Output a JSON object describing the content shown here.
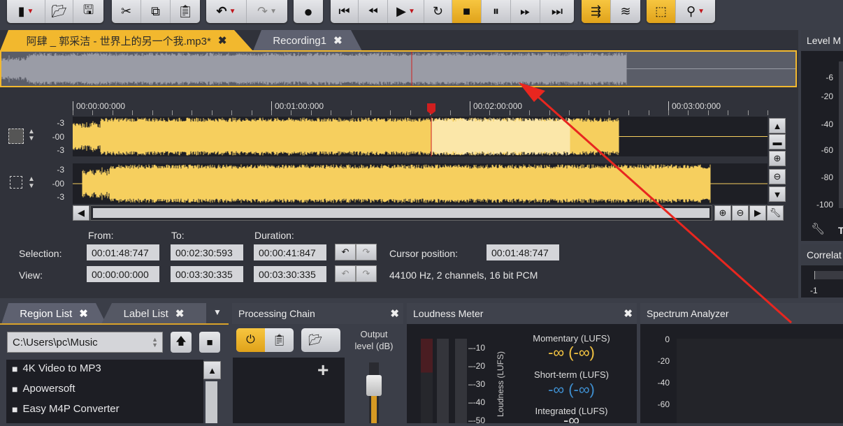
{
  "toolbar": {
    "new": "new-file-icon",
    "open": "open-folder-icon",
    "save": "save-icon",
    "cut": "cut-icon",
    "copy": "copy-icon",
    "paste": "paste-icon",
    "undo": "undo-icon",
    "redo": "redo-icon",
    "record": "record-icon",
    "go_start": "skip-start-icon",
    "rewind": "rewind-icon",
    "play": "play-icon",
    "loop": "loop-icon",
    "stop": "stop-icon",
    "pause": "pause-icon",
    "fast_forward": "fast-forward-icon",
    "go_end": "skip-end-icon",
    "accent": "#f2b82e"
  },
  "tabs": [
    {
      "label": "阿肆 _ 郭采洁 - 世界上的另一个我.mp3*",
      "active": true
    },
    {
      "label": "Recording1",
      "active": false
    }
  ],
  "close_glyph": "✖",
  "ruler": [
    "00:00:00:000",
    "00:01:00:000",
    "00:02:00:000",
    "00:03:00:000"
  ],
  "track_scale": [
    "-3",
    "-00",
    "-3"
  ],
  "selection": {
    "from_label": "From:",
    "to_label": "To:",
    "duration_label": "Duration:",
    "selection_label": "Selection:",
    "view_label": "View:",
    "sel_from": "00:01:48:747",
    "sel_to": "00:02:30:593",
    "sel_dur": "00:00:41:847",
    "view_from": "00:00:00:000",
    "view_to": "00:03:30:335",
    "view_dur": "00:03:30:335",
    "cursor_label": "Cursor position:",
    "cursor": "00:01:48:747",
    "format": "44100 Hz, 2 channels, 16 bit PCM"
  },
  "level_meter": {
    "title": "Level M",
    "ticks": [
      "-6",
      "-20",
      "-40",
      "-60",
      "-80",
      "-100"
    ],
    "t": "T"
  },
  "correlation": {
    "title": "Correlat",
    "tick": "-1"
  },
  "region_tabs": [
    {
      "label": "Region List"
    },
    {
      "label": "Label List"
    }
  ],
  "file_browser": {
    "path": "C:\\Users\\pc\\Music",
    "items": [
      "4K Video to MP3",
      "Apowersoft",
      "Easy M4P Converter"
    ]
  },
  "processing": {
    "title": "Processing Chain",
    "output_label": "Output level (dB)",
    "add": "+"
  },
  "loudness": {
    "title": "Loudness Meter",
    "ticks": [
      "-10",
      "-20",
      "-30",
      "-40",
      "-50"
    ],
    "axis": "Loudness (LUFS)",
    "momentary_label": "Momentary (LUFS)",
    "momentary": "-∞ (-∞)",
    "short_label": "Short-term (LUFS)",
    "short": "-∞ (-∞)",
    "integrated_label": "Integrated (LUFS)",
    "integrated": "-∞",
    "colors": {
      "momentary": "#f5c542",
      "short": "#3f8fd0"
    }
  },
  "spectrum": {
    "title": "Spectrum Analyzer",
    "ticks": [
      "0",
      "-20",
      "-40",
      "-60"
    ]
  }
}
